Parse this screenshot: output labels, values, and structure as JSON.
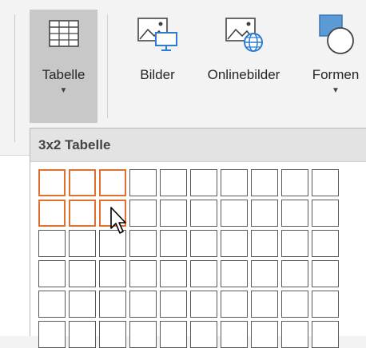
{
  "ribbon": {
    "buttons": [
      {
        "label": "Tabelle",
        "icon": "table-icon"
      },
      {
        "label": "Bilder",
        "icon": "pictures-icon"
      },
      {
        "label": "Onlinebilder",
        "icon": "online-pictures-icon"
      },
      {
        "label": "Formen",
        "icon": "shapes-icon"
      }
    ]
  },
  "table_picker": {
    "header": "3x2 Tabelle",
    "columns": 10,
    "rows": 6,
    "selected_columns": 3,
    "selected_rows": 2
  },
  "colors": {
    "selection": "#e07030",
    "cell_border": "#595959",
    "pressed_button": "#c8c8c8"
  }
}
